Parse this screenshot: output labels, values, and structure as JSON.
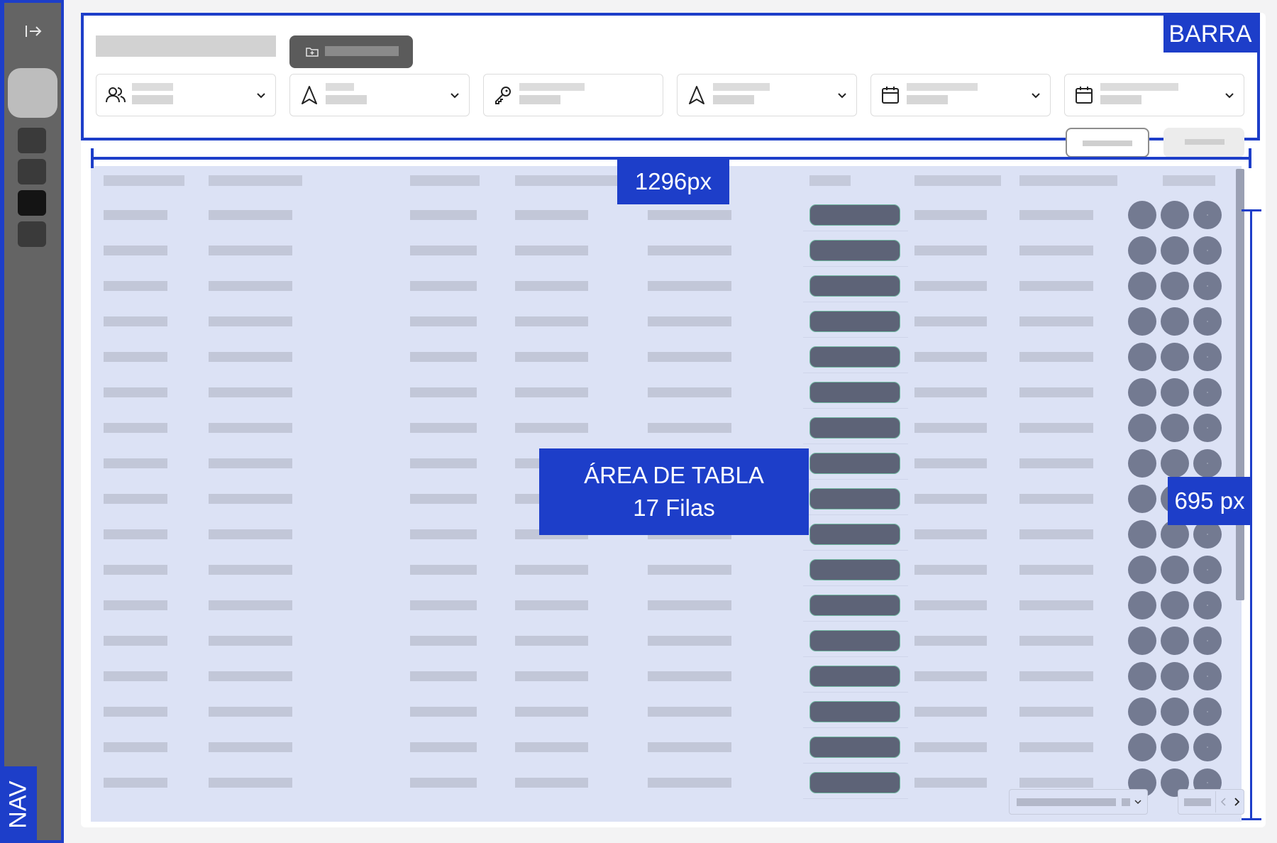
{
  "nav": {
    "tag_label": "NAV",
    "collapse_icon": "expand-arrow-icon",
    "items": [
      {
        "icon": "nav-item-icon",
        "active": false
      },
      {
        "icon": "nav-item-icon",
        "active": false
      },
      {
        "icon": "nav-item-icon",
        "active": true
      },
      {
        "icon": "nav-item-icon",
        "active": false
      }
    ]
  },
  "toolbar": {
    "tag_label": "BARRA",
    "new_button_icon": "folder-plus-icon",
    "filters": [
      {
        "icon": "users-icon",
        "has_dropdown": true
      },
      {
        "icon": "navigation-icon",
        "has_dropdown": true
      },
      {
        "icon": "key-icon",
        "has_dropdown": false
      },
      {
        "icon": "navigation-icon",
        "has_dropdown": true
      },
      {
        "icon": "calendar-icon",
        "has_dropdown": true
      },
      {
        "icon": "calendar-icon",
        "has_dropdown": true
      }
    ]
  },
  "table": {
    "width_label": "1296px",
    "height_label": "695 px",
    "area_label_line1": "ÁREA DE TABLA",
    "area_label_line2": "17 Filas",
    "row_count": 17,
    "row_action_icons": [
      "circle-action-icon",
      "circle-action-icon",
      "circle-action-icon"
    ]
  },
  "pagination": {
    "prev_icon": "chevron-left-icon",
    "next_icon": "chevron-right-icon"
  },
  "colors": {
    "annotation": "#1d3ec9",
    "nav_bg": "#646464",
    "table_bg": "#dce2f5",
    "pill": "#5d6377",
    "circle": "#737a91"
  }
}
